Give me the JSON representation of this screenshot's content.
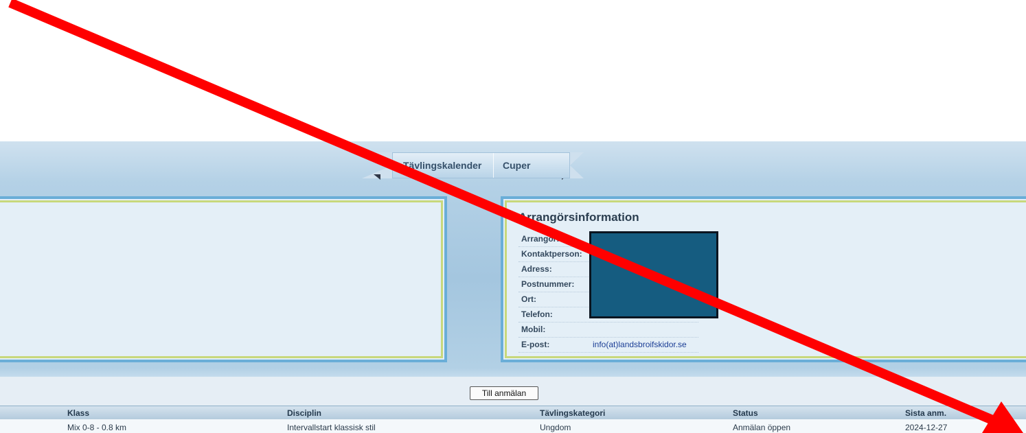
{
  "nav": {
    "tabs": [
      {
        "label": "Tävlingskalender"
      },
      {
        "label": "Cuper"
      }
    ]
  },
  "organizer": {
    "title": "Arrangörsinformation",
    "rows": [
      {
        "label": "Arrangör:",
        "value": ""
      },
      {
        "label": "Kontaktperson:",
        "value": ""
      },
      {
        "label": "Adress:",
        "value": ""
      },
      {
        "label": "Postnummer:",
        "value": ""
      },
      {
        "label": "Ort:",
        "value": ""
      },
      {
        "label": "Telefon:",
        "value": ""
      },
      {
        "label": "Mobil:",
        "value": ""
      },
      {
        "label": "E-post:",
        "value": "info(at)landsbroifskidor.se"
      }
    ]
  },
  "signup_button": "Till anmälan",
  "table": {
    "headers": [
      "Klass",
      "Disciplin",
      "Tävlingskategori",
      "Status",
      "Sista anm."
    ],
    "rows": [
      [
        "Mix 0-8 - 0.8 km",
        "Intervallstart klassisk stil",
        "Ungdom",
        "Anmälan öppen",
        "2024-12-27"
      ]
    ]
  },
  "annotation": {
    "arrow_color": "#ff0000",
    "redaction_color": "#155c80"
  }
}
